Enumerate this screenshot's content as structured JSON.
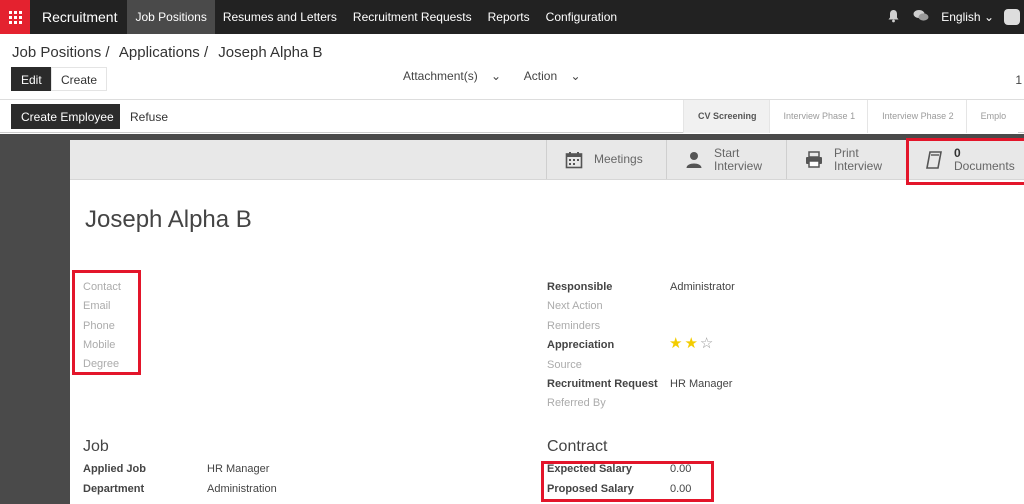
{
  "navbar": {
    "brand": "Recruitment",
    "menu": [
      "Job Positions",
      "Resumes and Letters",
      "Recruitment Requests",
      "Reports",
      "Configuration"
    ],
    "language": "English"
  },
  "control_panel": {
    "breadcrumb": [
      "Job Positions /",
      "Applications /",
      "Joseph Alpha B"
    ],
    "edit_label": "Edit",
    "create_label": "Create",
    "attachments_label": "Attachment(s)",
    "action_label": "Action",
    "pager_value": "1"
  },
  "statusbar": {
    "create_employee_label": "Create Employee",
    "refuse_label": "Refuse",
    "stages": [
      "CV Screening",
      "Interview Phase 1",
      "Interview Phase 2",
      "Emplo"
    ],
    "current_stage": "CV Screening"
  },
  "button_box": {
    "meetings_label": "Meetings",
    "start_interview_1": "Start",
    "start_interview_2": "Interview",
    "print_interview_1": "Print",
    "print_interview_2": "Interview",
    "documents_count": "0",
    "documents_label": "Documents"
  },
  "form": {
    "name": "Joseph Alpha B",
    "left_labels": {
      "contact": "Contact",
      "email": "Email",
      "phone": "Phone",
      "mobile": "Mobile",
      "degree": "Degree"
    },
    "right_fields": {
      "responsible_label": "Responsible",
      "responsible_value": "Administrator",
      "next_action_label": "Next Action",
      "reminders_label": "Reminders",
      "appreciation_label": "Appreciation",
      "appreciation_stars": 2,
      "appreciation_max": 3,
      "source_label": "Source",
      "recruitment_request_label": "Recruitment Request",
      "recruitment_request_value": "HR Manager",
      "referred_by_label": "Referred By"
    },
    "job": {
      "title": "Job",
      "applied_job_label": "Applied Job",
      "applied_job_value": "HR Manager",
      "department_label": "Department",
      "department_value": "Administration"
    },
    "contract": {
      "title": "Contract",
      "expected_salary_label": "Expected Salary",
      "expected_salary_value": "0.00",
      "proposed_salary_label": "Proposed Salary",
      "proposed_salary_value": "0.00"
    }
  },
  "colors": {
    "navbar": "#222222",
    "apps_button": "#e4222f",
    "highlight_box": "#e3152a",
    "star_active": "#f3cc00"
  }
}
